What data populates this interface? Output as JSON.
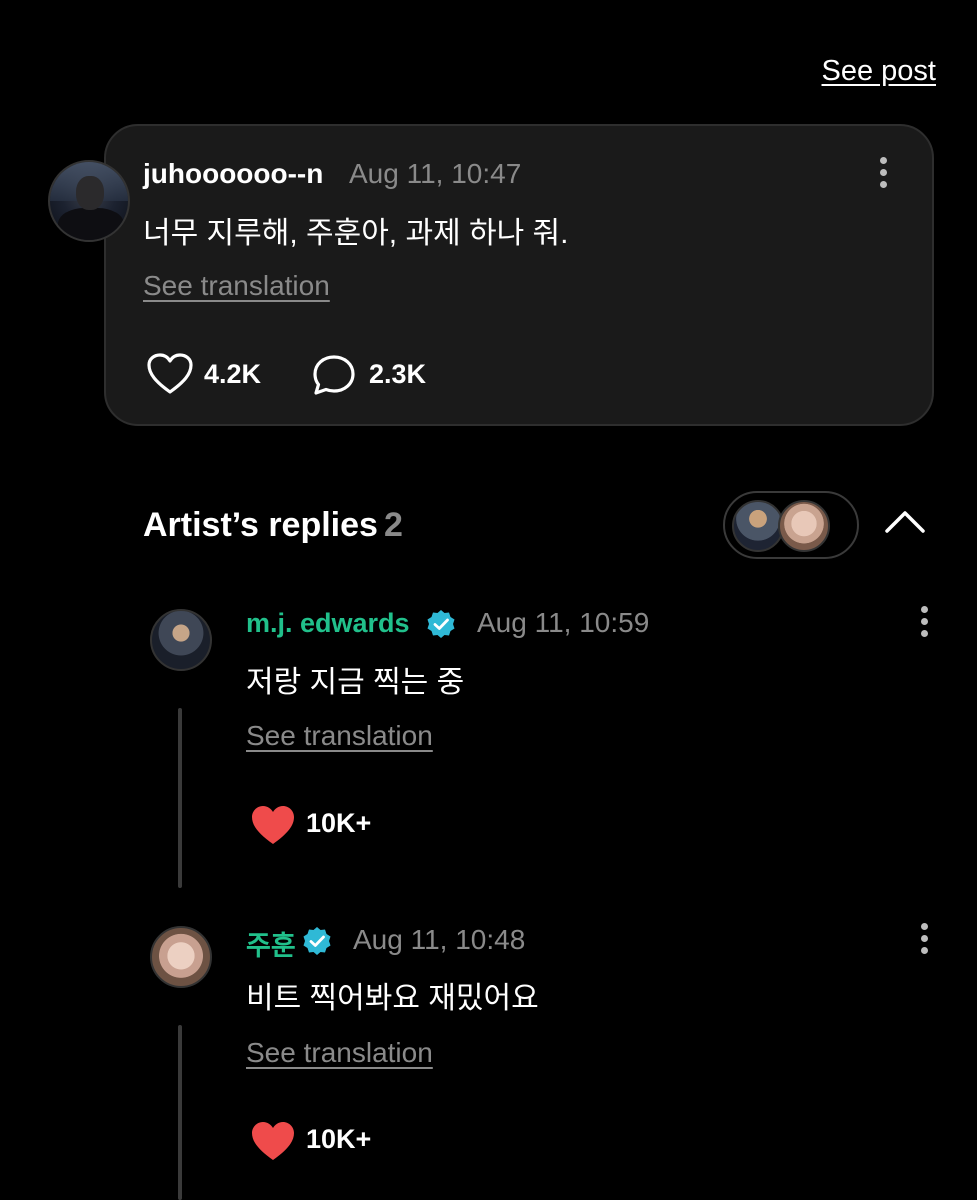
{
  "header": {
    "see_post": "See post"
  },
  "post": {
    "username": "juhoooooo--n",
    "timestamp": "Aug 11, 10:47",
    "text": "너무 지루해, 주훈아, 과제 하나 줘.",
    "see_translation": "See translation",
    "likes": "4.2K",
    "comments": "2.3K"
  },
  "artist_replies": {
    "title": "Artist’s replies",
    "count": "2"
  },
  "replies": [
    {
      "username": "m.j. edwards",
      "timestamp": "Aug 11, 10:59",
      "text": "저랑 지금 찍는 중",
      "see_translation": "See translation",
      "likes": "10K+"
    },
    {
      "username": "주훈",
      "timestamp": "Aug 11, 10:48",
      "text": "비트 찍어봐요 재밌어요",
      "see_translation": "See translation",
      "likes": "10K+"
    }
  ],
  "colors": {
    "background": "#000000",
    "card": "#1a1a1a",
    "artist_name": "#21c08b",
    "verified": "#2fb9d6",
    "heart_filled": "#ef4b4b",
    "muted_text": "#8a8a8a"
  },
  "icons": [
    "heart-outline-icon",
    "comment-bubble-icon",
    "heart-filled-icon",
    "verified-badge-icon",
    "more-options-icon",
    "chevron-up-icon"
  ]
}
